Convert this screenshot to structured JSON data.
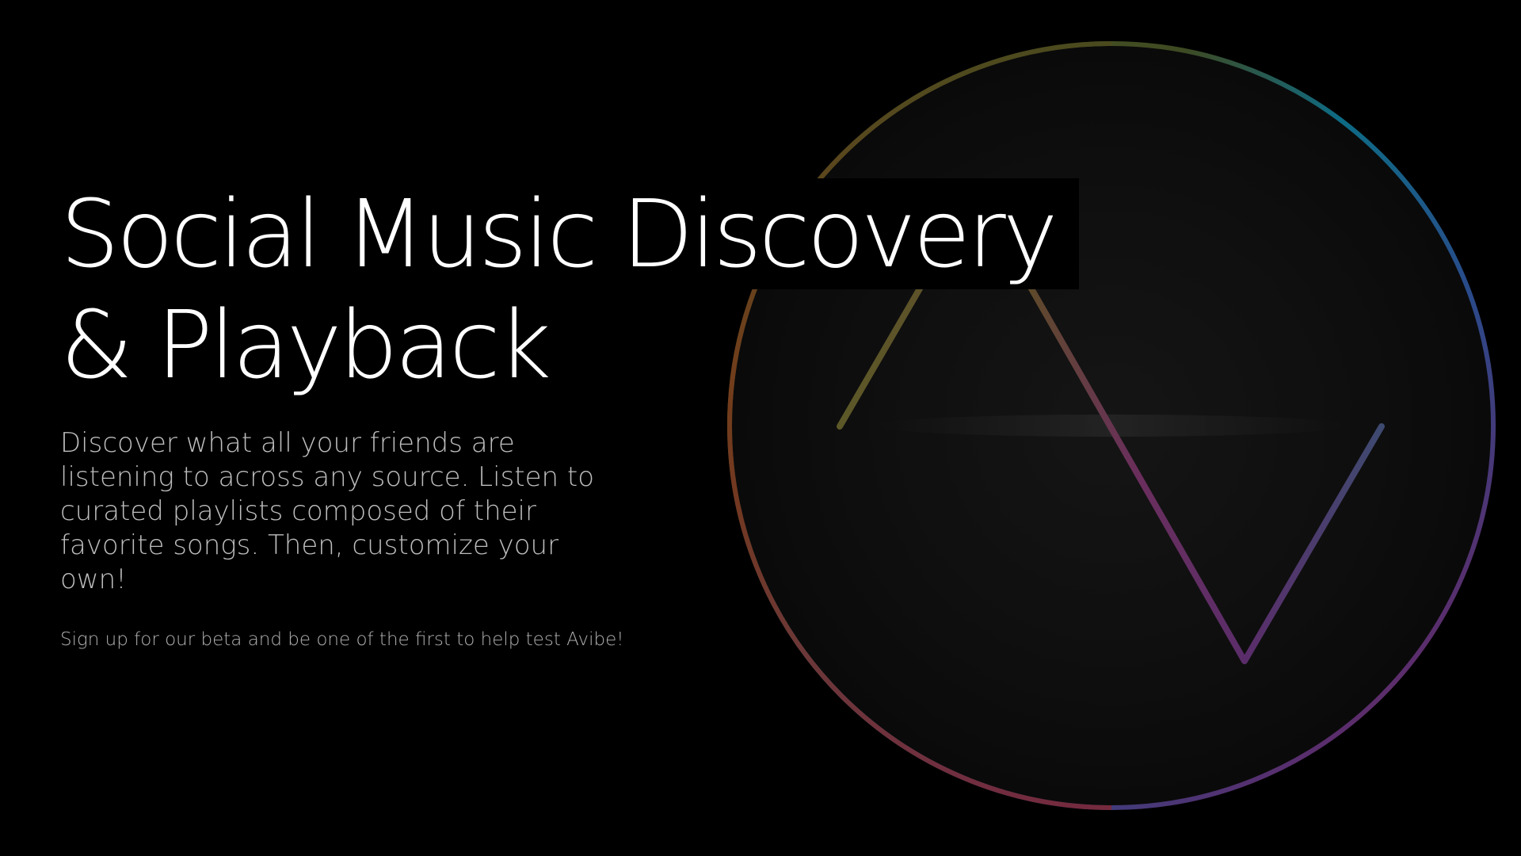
{
  "hero": {
    "headline_line1": "Social Music Discovery",
    "headline_line2": "& Playback",
    "description": "Discover what all your friends are listening to across any source. Listen to curated playlists composed of their favorite songs. Then, customize your own!",
    "signup_text": "Sign up for our beta and be one of the first to help test Avibe!"
  },
  "logo": {
    "icon": "avibe-circle-wave-logo",
    "ring_colors": [
      "#3f4a1c",
      "#0f6f8a",
      "#2b4a8c",
      "#5a2f6e",
      "#8c2a3a",
      "#7a3a1c",
      "#5a4a1c"
    ],
    "wave_colors": [
      "#5c5a2a",
      "#6b4a3a",
      "#6a2f6a",
      "#3f4a6e"
    ]
  }
}
